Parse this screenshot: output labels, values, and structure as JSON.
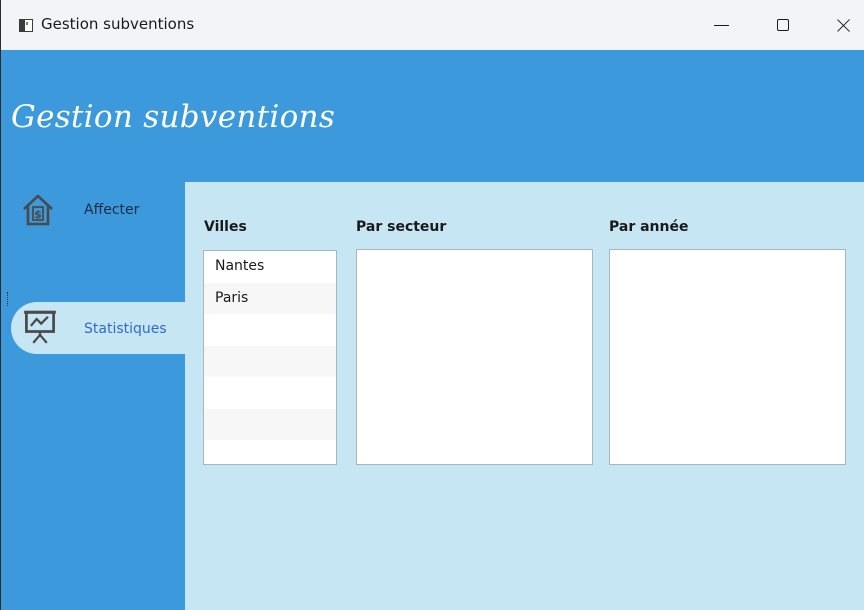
{
  "window": {
    "title": "Gestion subventions"
  },
  "header": {
    "title": "Gestion subventions"
  },
  "sidebar": {
    "items": [
      {
        "label": "Affecter",
        "icon": "house-dollar-icon",
        "selected": false
      },
      {
        "label": "Statistiques",
        "icon": "presentation-chart-icon",
        "selected": true
      }
    ]
  },
  "main": {
    "villes_label": "Villes",
    "secteur_label": "Par secteur",
    "annee_label": "Par année",
    "villes": [
      "Nantes",
      "Paris",
      "",
      "",
      "",
      "",
      ""
    ]
  },
  "colors": {
    "accent": "#3b99dc",
    "content_bg": "#c7e6f3",
    "selected_text": "#2f6bc9"
  }
}
